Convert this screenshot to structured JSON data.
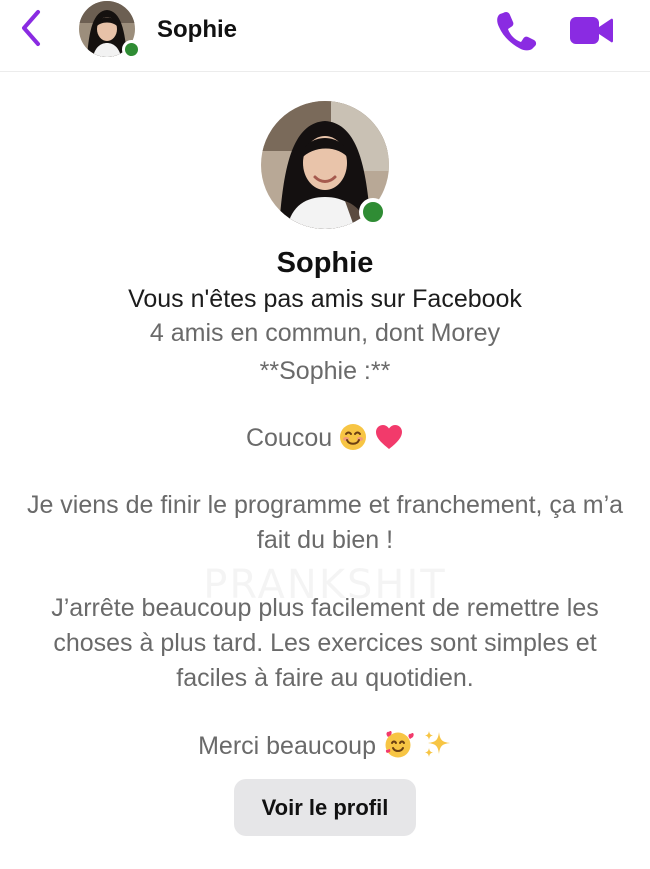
{
  "header": {
    "back_icon": "chevron-left-icon",
    "name": "Sophie",
    "online": true,
    "call_icon": "phone-icon",
    "video_icon": "video-camera-icon",
    "accent_color": "#8a2be2"
  },
  "profile": {
    "name": "Sophie",
    "friend_status": "Vous n'êtes pas amis sur Facebook",
    "mutual_friends": "4 amis en commun, dont Morey",
    "online_color": "#2f8c34"
  },
  "message": {
    "signature": "**Sophie :**",
    "greeting": "Coucou",
    "greeting_emojis": [
      "smiling-face-icon",
      "heart-icon"
    ],
    "paragraph_1": "Je viens de finir le programme et franchement, ça m’a fait du bien !",
    "paragraph_2": "J’arrête beaucoup plus facilement de remettre les choses à plus tard. Les exercices sont simples et faciles à faire au quotidien.",
    "thanks": "Merci beaucoup",
    "thanks_emojis": [
      "smiling-face-with-hearts-icon",
      "sparkles-icon"
    ]
  },
  "watermark": "PRANKSHIT",
  "actions": {
    "view_profile_label": "Voir le profil"
  }
}
